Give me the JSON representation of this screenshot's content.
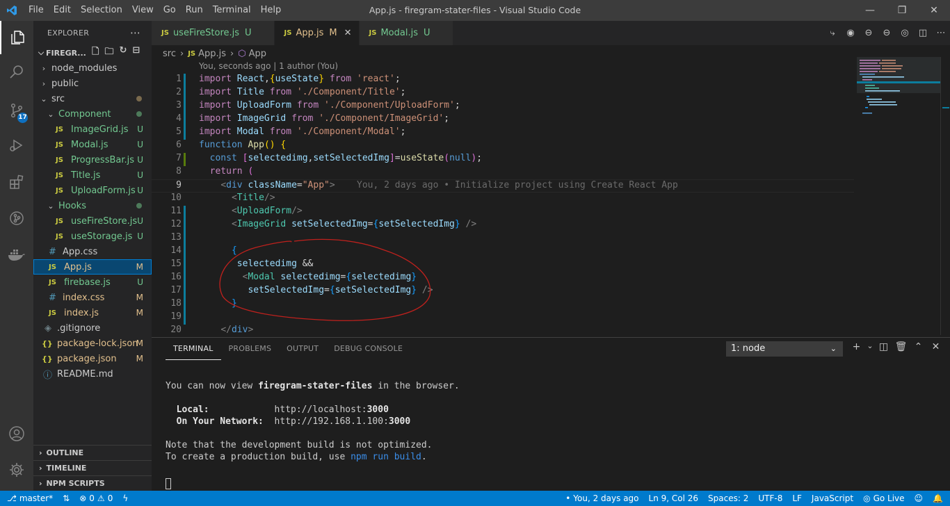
{
  "menu": [
    "File",
    "Edit",
    "Selection",
    "View",
    "Go",
    "Run",
    "Terminal",
    "Help"
  ],
  "window_title": "App.js - firegram-stater-files - Visual Studio Code",
  "activity": {
    "scm_badge": "17"
  },
  "sidebar": {
    "title": "EXPLORER",
    "project": "FIREGR...",
    "tree": [
      {
        "label": "node_modules",
        "kind": "folder",
        "indent": 0,
        "status": ""
      },
      {
        "label": "public",
        "kind": "folder",
        "indent": 0,
        "status": ""
      },
      {
        "label": "src",
        "kind": "folder-open",
        "indent": 0,
        "status": "dot-mod"
      },
      {
        "label": "Component",
        "kind": "folder-open",
        "indent": 1,
        "status": "dot-green"
      },
      {
        "label": "ImageGrid.js",
        "kind": "js",
        "indent": 2,
        "status": "U"
      },
      {
        "label": "Modal.js",
        "kind": "js",
        "indent": 2,
        "status": "U"
      },
      {
        "label": "ProgressBar.js",
        "kind": "js",
        "indent": 2,
        "status": "U"
      },
      {
        "label": "Title.js",
        "kind": "js",
        "indent": 2,
        "status": "U"
      },
      {
        "label": "UploadForm.js",
        "kind": "js",
        "indent": 2,
        "status": "U"
      },
      {
        "label": "Hooks",
        "kind": "folder-open",
        "indent": 1,
        "status": "dot-green"
      },
      {
        "label": "useFireStore.js",
        "kind": "js",
        "indent": 2,
        "status": "U"
      },
      {
        "label": "useStorage.js",
        "kind": "js",
        "indent": 2,
        "status": "U"
      },
      {
        "label": "App.css",
        "kind": "css",
        "indent": 1,
        "status": ""
      },
      {
        "label": "App.js",
        "kind": "js",
        "indent": 1,
        "status": "M"
      },
      {
        "label": "firebase.js",
        "kind": "js",
        "indent": 1,
        "status": "U"
      },
      {
        "label": "index.css",
        "kind": "css",
        "indent": 1,
        "status": "M"
      },
      {
        "label": "index.js",
        "kind": "js",
        "indent": 1,
        "status": "M"
      },
      {
        "label": ".gitignore",
        "kind": "git",
        "indent": 0,
        "status": ""
      },
      {
        "label": "package-lock.json",
        "kind": "json",
        "indent": 0,
        "status": "M"
      },
      {
        "label": "package.json",
        "kind": "json",
        "indent": 0,
        "status": "M"
      },
      {
        "label": "README.md",
        "kind": "info",
        "indent": 0,
        "status": ""
      }
    ],
    "sections": [
      "OUTLINE",
      "TIMELINE",
      "NPM SCRIPTS"
    ]
  },
  "tabs": [
    {
      "label": "useFireStore.js",
      "status": "U",
      "active": false
    },
    {
      "label": "App.js",
      "status": "M",
      "active": true
    },
    {
      "label": "Modal.js",
      "status": "U",
      "active": false
    }
  ],
  "breadcrumb": {
    "folder": "src",
    "file": "App.js",
    "symbol": "App"
  },
  "blame_header": "You, seconds ago | 1 author (You)",
  "code_lines": [
    {
      "n": "1",
      "html": "<span class='kw'>import</span> <span class='v'>React</span>,<span class='b'>{</span><span class='v'>useState</span><span class='b'>}</span> <span class='kw'>from</span> <span class='s'>'react'</span>;",
      "gutter": "#0c7d9d"
    },
    {
      "n": "2",
      "html": "<span class='kw'>import</span> <span class='v'>Title</span> <span class='kw'>from</span> <span class='s'>'./Component/Title'</span>;",
      "gutter": "#0c7d9d"
    },
    {
      "n": "3",
      "html": "<span class='kw'>import</span> <span class='v'>UploadForm</span> <span class='kw'>from</span> <span class='s'>'./Component/UploadForm'</span>;",
      "gutter": "#0c7d9d"
    },
    {
      "n": "4",
      "html": "<span class='kw'>import</span> <span class='v'>ImageGrid</span> <span class='kw'>from</span> <span class='s'>'./Component/ImageGrid'</span>;",
      "gutter": "#0c7d9d"
    },
    {
      "n": "5",
      "html": "<span class='kw'>import</span> <span class='v'>Modal</span> <span class='kw'>from</span> <span class='s'>'./Component/Modal'</span>;",
      "gutter": "#0c7d9d"
    },
    {
      "n": "6",
      "html": "<span class='k'>function</span> <span class='f'>App</span><span class='b'>()</span> <span class='b'>{</span>",
      "gutter": ""
    },
    {
      "n": "7",
      "html": "  <span class='k'>const</span> <span class='b2'>[</span><span class='v'>selectedimg</span>,<span class='v'>setSelectedImg</span><span class='b2'>]</span>=<span class='f'>useState</span><span class='b2'>(</span><span class='k'>null</span><span class='b2'>)</span>;",
      "gutter": "#587c0c"
    },
    {
      "n": "8",
      "html": "  <span class='kw'>return</span> <span class='b2'>(</span>",
      "gutter": ""
    },
    {
      "n": "9",
      "html": "    <span class='p'>&lt;</span><span class='k'>div</span> <span class='v'>className</span>=<span class='s'>\"App\"</span><span class='p'>&gt;</span>    <span class='ghost'>You, 2 days ago • Initialize project using Create React App</span>",
      "gutter": "",
      "current": true
    },
    {
      "n": "10",
      "html": "      <span class='p'>&lt;</span><span class='t'>Title</span><span class='p'>/&gt;</span>",
      "gutter": ""
    },
    {
      "n": "11",
      "html": "      <span class='p'>&lt;</span><span class='t'>UploadForm</span><span class='p'>/&gt;</span>",
      "gutter": "#0c7d9d"
    },
    {
      "n": "12",
      "html": "      <span class='p'>&lt;</span><span class='t'>ImageGrid</span> <span class='v'>setSelectedImg</span>=<span class='b3'>{</span><span class='v'>setSelectedImg</span><span class='b3'>}</span> <span class='p'>/&gt;</span>",
      "gutter": "#0c7d9d"
    },
    {
      "n": "13",
      "html": "",
      "gutter": "#0c7d9d"
    },
    {
      "n": "14",
      "html": "      <span class='b3'>{</span>",
      "gutter": "#0c7d9d"
    },
    {
      "n": "15",
      "html": "       <span class='v'>selectedimg</span> &amp;&amp;",
      "gutter": "#0c7d9d"
    },
    {
      "n": "16",
      "html": "        <span class='p'>&lt;</span><span class='t'>Modal</span> <span class='v'>selectedimg</span>=<span class='b3'>{</span><span class='v'>selectedimg</span><span class='b3'>}</span>",
      "gutter": "#0c7d9d"
    },
    {
      "n": "17",
      "html": "         <span class='v'>setSelectedImg</span>=<span class='b3'>{</span><span class='v'>setSelectedImg</span><span class='b3'>}</span> <span class='p'>/&gt;</span>",
      "gutter": "#0c7d9d"
    },
    {
      "n": "18",
      "html": "      <span class='b3'>}</span>",
      "gutter": "#0c7d9d"
    },
    {
      "n": "19",
      "html": "",
      "gutter": "#0c7d9d"
    },
    {
      "n": "20",
      "html": "    <span class='p'>&lt;/</span><span class='k'>div</span><span class='p'>&gt;</span>",
      "gutter": ""
    }
  ],
  "panel": {
    "tabs": [
      "TERMINAL",
      "PROBLEMS",
      "OUTPUT",
      "DEBUG CONSOLE"
    ],
    "terminal_select": "1: node",
    "lines": [
      {
        "pre": "You can now view ",
        "bold": "firegram-stater-files",
        "post": " in the browser."
      },
      {
        "pre": "",
        "bold": "",
        "post": ""
      },
      {
        "pre": "  ",
        "bold": "Local:",
        "post": "            http://localhost:",
        "bold2": "3000"
      },
      {
        "pre": "  ",
        "bold": "On Your Network:",
        "post": "  http://192.168.1.100:",
        "bold2": "3000"
      },
      {
        "pre": "",
        "bold": "",
        "post": ""
      },
      {
        "pre": "Note that the development build is not optimized.",
        "bold": "",
        "post": ""
      },
      {
        "pre": "To create a production build, use ",
        "bold": "",
        "post": "",
        "cmd": "npm run build",
        "tail": "."
      }
    ]
  },
  "status": {
    "branch": "master*",
    "errors": "0",
    "warnings": "0",
    "blame": "You, 2 days ago",
    "position": "Ln 9, Col 26",
    "spaces": "Spaces: 2",
    "encoding": "UTF-8",
    "eol": "LF",
    "language": "JavaScript",
    "golive": "Go Live"
  },
  "colors": {
    "accent": "#007acc",
    "annotation": "#c0211d"
  }
}
